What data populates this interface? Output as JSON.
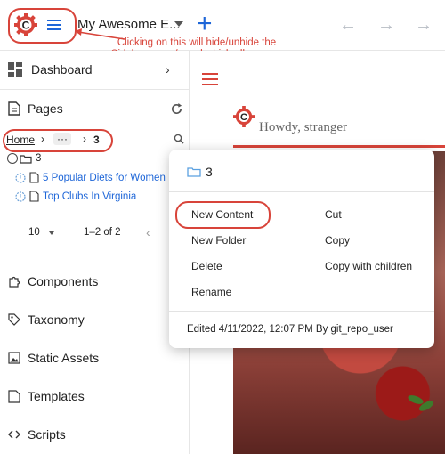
{
  "topbar": {
    "site_name": "My Awesome E...",
    "add_icon": "plus-icon",
    "back_icon": "arrow-left-icon",
    "forward_icon": "arrow-right-icon",
    "annotation": "Clicking on this will hide/unhide the Sidebar menu/panel which allows you access to various tools and content"
  },
  "sidebar": {
    "dashboard_label": "Dashboard",
    "pages_label": "Pages",
    "breadcrumb": {
      "home": "Home",
      "ellipsis": "···",
      "current": "3"
    },
    "tree": {
      "folder_label": "3",
      "items": [
        "5 Popular Diets for Women",
        "Top Clubs In Virginia"
      ]
    },
    "pagination": {
      "per_page": "10",
      "range": "1–2 of 2"
    },
    "sections": [
      "Components",
      "Taxonomy",
      "Static Assets",
      "Templates",
      "Scripts"
    ]
  },
  "preview": {
    "greeting": "Howdy, stranger"
  },
  "context_menu": {
    "title": "3",
    "items_left": [
      "New Content",
      "New Folder",
      "Delete",
      "Rename"
    ],
    "items_right": [
      "Cut",
      "Copy",
      "Copy with children"
    ],
    "footer": "Edited 4/11/2022, 12:07 PM By git_repo_user"
  },
  "colors": {
    "accent_red": "#d8443a",
    "accent_blue": "#1e66d8"
  }
}
